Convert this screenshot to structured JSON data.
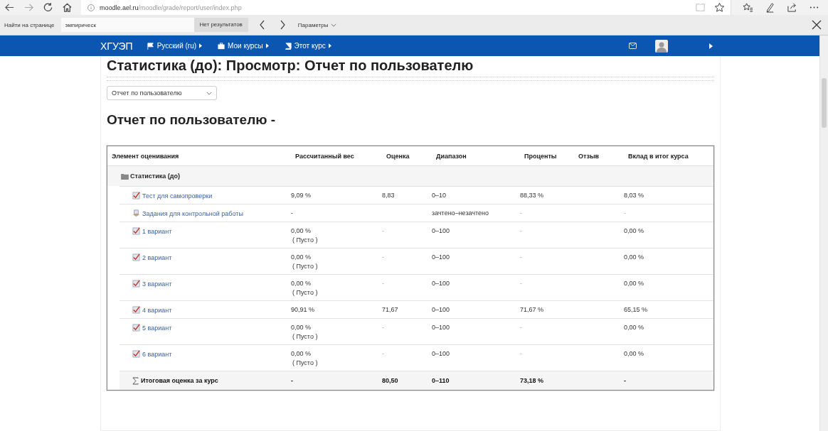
{
  "browser": {
    "url_host": "moodle.ael.ru",
    "url_path": "/moodle/grade/report/user/index.php"
  },
  "find_bar": {
    "label": "Найти на странице",
    "value": "эмпирическ",
    "result": "Нет результатов",
    "options": "Параметры"
  },
  "nav": {
    "brand": "ХГУЭП",
    "items": [
      {
        "label": "Русский (ru)",
        "kind": "language"
      },
      {
        "label": "Мои курсы",
        "kind": "courses"
      },
      {
        "label": "Этот курс",
        "kind": "course"
      }
    ]
  },
  "page": {
    "title": "Статистика (до): Просмотр: Отчет по пользователю",
    "report_select": "Отчет по пользователю",
    "heading": "Отчет по пользователю -"
  },
  "table": {
    "columns": [
      "Элемент оценивания",
      "Рассчитанный вес",
      "Оценка",
      "Диапазон",
      "Проценты",
      "Отзыв",
      "Вклад в итог курса"
    ],
    "category": "Статистика (до)",
    "rows": [
      {
        "kind": "quiz",
        "name": "Тест для самопроверки",
        "weight": "9,09 %",
        "grade": "8,83",
        "range": "0–10",
        "percent": "88,33 %",
        "contribution": "8,03 %"
      },
      {
        "kind": "assignment",
        "name": "Задания для контрольной работы",
        "weight": "-",
        "range": "зачтено–незачтено",
        "percent": "-",
        "contribution": "-"
      },
      {
        "kind": "quiz",
        "name": "1 вариант",
        "weight": "0,00 %",
        "weight_note": "( Пусто )",
        "grade": "-",
        "range": "0–100",
        "percent": "-",
        "contribution": "0,00 %"
      },
      {
        "kind": "quiz",
        "name": "2 вариант",
        "weight": "0,00 %",
        "weight_note": "( Пусто )",
        "grade": "-",
        "range": "0–100",
        "percent": "-",
        "contribution": "0,00 %"
      },
      {
        "kind": "quiz",
        "name": "3 вариант",
        "weight": "0,00 %",
        "weight_note": "( Пусто )",
        "grade": "-",
        "range": "0–100",
        "percent": "-",
        "contribution": "0,00 %"
      },
      {
        "kind": "quiz",
        "name": "4 вариант",
        "weight": "90,91 %",
        "grade": "71,67",
        "range": "0–100",
        "percent": "71,67 %",
        "contribution": "65,15 %"
      },
      {
        "kind": "quiz",
        "name": "5 вариант",
        "weight": "0,00 %",
        "weight_note": "( Пусто )",
        "grade": "-",
        "range": "0–100",
        "percent": "-",
        "contribution": "0,00 %"
      },
      {
        "kind": "quiz",
        "name": "6 вариант",
        "weight": "0,00 %",
        "weight_note": "( Пусто )",
        "grade": "-",
        "range": "0–100",
        "percent": "-",
        "contribution": "0,00 %"
      }
    ],
    "total": {
      "name": "Итоговая оценка за курс",
      "weight": "-",
      "grade": "80,50",
      "range": "0–110",
      "percent": "73,18 %",
      "contribution": "-"
    }
  }
}
